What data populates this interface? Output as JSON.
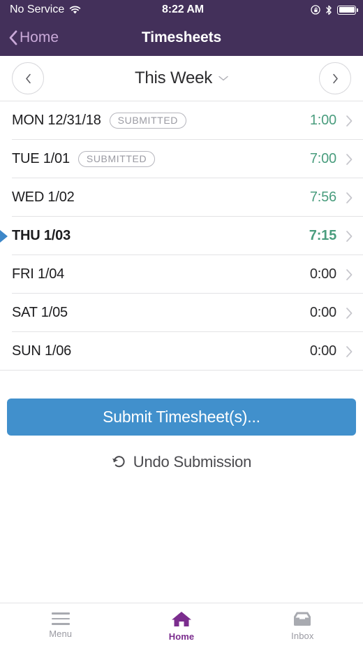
{
  "status_bar": {
    "carrier": "No Service",
    "time": "8:22 AM",
    "wifi_icon": "wifi-icon",
    "rotation_lock_icon": "rotation-lock-icon",
    "bluetooth_icon": "bluetooth-icon",
    "battery_icon": "battery-icon"
  },
  "nav": {
    "back_label": "Home",
    "back_icon": "chevron-left-icon",
    "title": "Timesheets"
  },
  "week_selector": {
    "prev_icon": "chevron-left-icon",
    "next_icon": "chevron-right-icon",
    "label": "This Week",
    "dropdown_icon": "chevron-down-icon"
  },
  "days": [
    {
      "name": "MON 12/31/18",
      "badge": "SUBMITTED",
      "hours": "1:00",
      "current": false,
      "zero": false
    },
    {
      "name": "TUE 1/01",
      "badge": "SUBMITTED",
      "hours": "7:00",
      "current": false,
      "zero": false
    },
    {
      "name": "WED 1/02",
      "badge": "",
      "hours": "7:56",
      "current": false,
      "zero": false
    },
    {
      "name": "THU 1/03",
      "badge": "",
      "hours": "7:15",
      "current": true,
      "zero": false
    },
    {
      "name": "FRI 1/04",
      "badge": "",
      "hours": "0:00",
      "current": false,
      "zero": true
    },
    {
      "name": "SAT 1/05",
      "badge": "",
      "hours": "0:00",
      "current": false,
      "zero": true
    },
    {
      "name": "SUN 1/06",
      "badge": "",
      "hours": "0:00",
      "current": false,
      "zero": true
    }
  ],
  "actions": {
    "submit_label": "Submit Timesheet(s)...",
    "undo_label": "Undo Submission",
    "undo_icon": "undo-arrow-icon"
  },
  "tabs": [
    {
      "label": "Menu",
      "icon": "hamburger-menu-icon",
      "active": false
    },
    {
      "label": "Home",
      "icon": "home-icon",
      "active": true
    },
    {
      "label": "Inbox",
      "icon": "inbox-tray-icon",
      "active": false
    }
  ],
  "colors": {
    "header_purple": "#43305a",
    "accent_purple": "#7b2d8e",
    "back_link": "#c9a9d8",
    "hours_green": "#4a9d7e",
    "submit_blue": "#4190cc",
    "marker_blue": "#3d87c8",
    "muted_gray": "#9a9aa2"
  }
}
